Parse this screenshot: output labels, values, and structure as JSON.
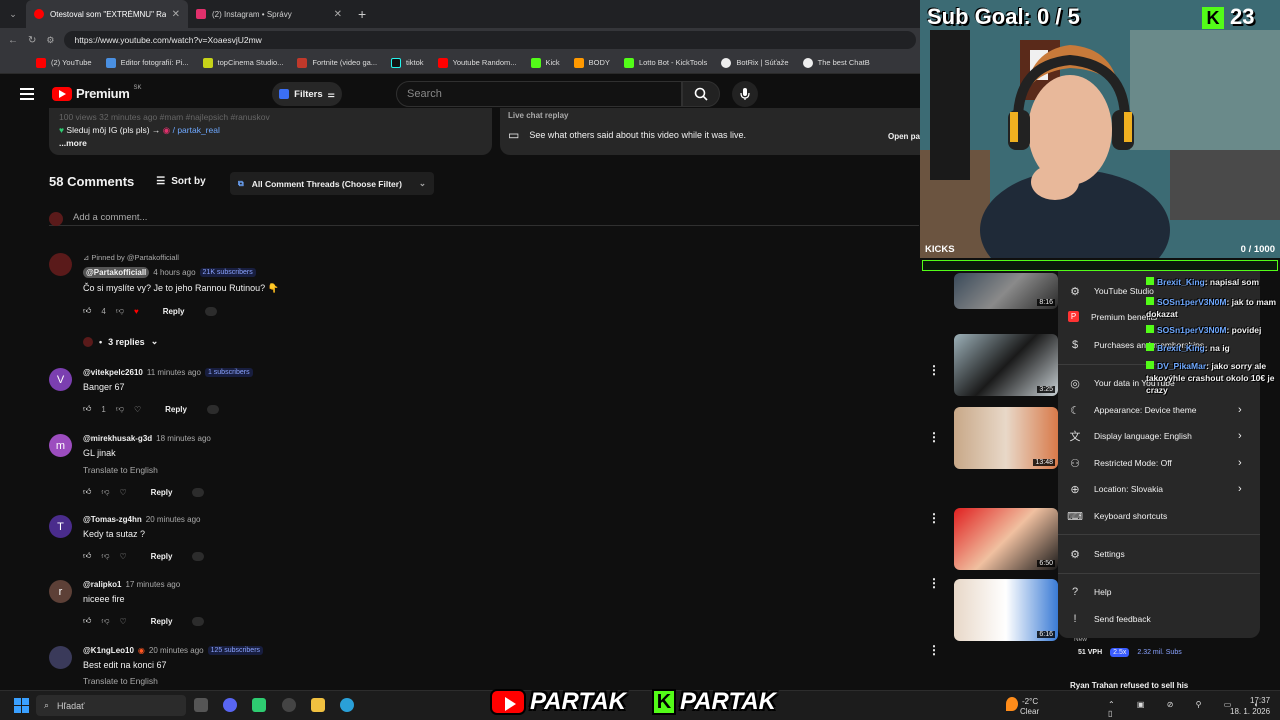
{
  "browser": {
    "tabs": [
      {
        "title": "Otestoval som \"EXTRÉMNU\" Rann",
        "color": "#ff0000"
      },
      {
        "title": "(2) Instagram • Správy",
        "color": "#e1306c"
      }
    ],
    "url": "https://www.youtube.com/watch?v=XoaesvjU2mw",
    "bookmarks": [
      "(2) YouTube",
      "Editor fotografií: Pi...",
      "topCinema Studio...",
      "Fortnite (video ga...",
      "tiktok",
      "Youtube Random...",
      "Kick",
      "BODY",
      "Lotto Bot - KickTools",
      "BotRix | Súťaže",
      "The best ChatB"
    ]
  },
  "yt": {
    "logo": "Premium",
    "logo_region": "SK",
    "filters": "Filters",
    "search_placeholder": "Search"
  },
  "description": {
    "line1": "100 views  32 minutes ago  #mam #najlepsich #ranuskov",
    "line2": "Sleduj môj IG (pls pls) →",
    "ig_handle": "/ partak_real",
    "more": "...more"
  },
  "live_chat": {
    "title": "Live chat replay",
    "text": "See what others said about this video while it was live.",
    "open": "Open pa"
  },
  "comments_header": {
    "count": "58 Comments",
    "sort": "Sort by",
    "filter": "All Comment Threads (Choose Filter)",
    "add_placeholder": "Add a comment..."
  },
  "comments": [
    {
      "pinned": "Pinned by @Partakofficiall",
      "name": "@Partakofficiall",
      "time": "4 hours ago",
      "subs": "21K subscribers",
      "text": "Čo si myslíte vy? Je to jeho Rannou Rutinou? 👇",
      "likes": "4",
      "reply": "Reply",
      "replies": "3 replies",
      "avatar_color": "#5a1a1a",
      "letter": ""
    },
    {
      "name": "@vitekpelc2610",
      "time": "11 minutes ago",
      "subs": "1 subscribers",
      "text": "Banger 67",
      "likes": "1",
      "reply": "Reply",
      "avatar_color": "#7b3fb0",
      "letter": "V"
    },
    {
      "name": "@mirekhusak-g3d",
      "time": "18 minutes ago",
      "text": "GL jinak",
      "translate": "Translate to English",
      "reply": "Reply",
      "avatar_color": "#9c4dbf",
      "letter": "m"
    },
    {
      "name": "@Tomas-zg4hn",
      "time": "20 minutes ago",
      "text": "Kedy ta sutaz ?",
      "reply": "Reply",
      "avatar_color": "#4a2c8c",
      "letter": "T"
    },
    {
      "name": "@ralipko1",
      "time": "17 minutes ago",
      "text": "niceee fire",
      "reply": "Reply",
      "avatar_color": "#5d4037",
      "letter": "r"
    },
    {
      "name": "@K1ngLeo10",
      "time": "20 minutes ago",
      "subs": "125 subscribers",
      "text": "Best edit na konci 67",
      "translate": "Translate to English",
      "avatar_color": "#3a3a5a",
      "letter": ""
    }
  ],
  "menu": {
    "items": [
      {
        "label": "YouTube Studio",
        "icon": "studio-icon"
      },
      {
        "label": "Premium benefits",
        "icon": "premium-icon"
      },
      {
        "label": "Purchases and memberships",
        "icon": "purchases-icon"
      },
      {
        "label": "Your data in YouTube",
        "icon": "data-icon"
      },
      {
        "label": "Appearance: Device theme",
        "icon": "appearance-icon",
        "arrow": true
      },
      {
        "label": "Display language: English",
        "icon": "language-icon",
        "arrow": true
      },
      {
        "label": "Restricted Mode: Off",
        "icon": "restricted-icon",
        "arrow": true
      },
      {
        "label": "Location: Slovakia",
        "icon": "globe-icon",
        "arrow": true
      },
      {
        "label": "Keyboard shortcuts",
        "icon": "keyboard-icon"
      },
      {
        "label": "Settings",
        "icon": "gear-icon"
      },
      {
        "label": "Help",
        "icon": "help-icon"
      },
      {
        "label": "Send feedback",
        "icon": "feedback-icon"
      }
    ]
  },
  "sidebar_videos": {
    "durations": [
      "8:16",
      "3:25",
      "13:48",
      "6:50",
      "6:16"
    ],
    "stats": {
      "vph": "51 VPH",
      "mult": "2.5x",
      "subs": "2.32 mil. Subs"
    },
    "new_badge": "New",
    "next_title": "Ryan Trahan refused to sell his"
  },
  "overlay": {
    "sub_goal": "Sub Goal:  0 / 5",
    "kick_followers": "23",
    "kicks_label": "KICKS",
    "kicks_value": "0  / 1000",
    "chat": [
      {
        "user": "Brexit_King",
        "msg": ": napisal som"
      },
      {
        "user": "SOSn1perV3N0M",
        "msg": ": jak to mam dokazat"
      },
      {
        "user": "SOSn1perV3N0M",
        "msg": ": povidej"
      },
      {
        "user": "Brexit_King",
        "msg": ": na ig"
      },
      {
        "user": "DV_PikaMar",
        "msg": ": jako sorry ale takovýhle crashout okolo 10€ je crazy"
      }
    ],
    "brand_yt": "PARTAK",
    "brand_kick": "PARTAK"
  },
  "taskbar": {
    "search": "Hľadať",
    "weather_temp": "-2°C",
    "weather_text": "Clear",
    "time": "17:37",
    "date": "18. 1. 2026"
  },
  "colors": {
    "youtube_red": "#ff0000",
    "kick_green": "#53fc18",
    "bg": "#0f0f0f"
  }
}
